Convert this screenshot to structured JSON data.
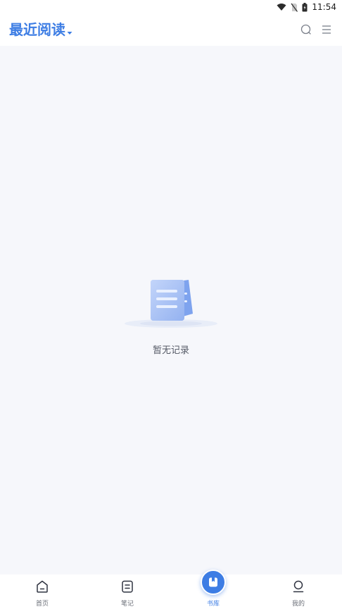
{
  "status_bar": {
    "time": "11:54",
    "icons": [
      "wifi-icon",
      "no-sim-icon",
      "battery-charging-icon"
    ]
  },
  "header": {
    "title": "最近阅读",
    "icons": [
      "chevron-down-icon",
      "search-icon",
      "menu-icon"
    ]
  },
  "empty_state": {
    "message": "暂无记录",
    "icon": "document-stack-illustration"
  },
  "tabbar": {
    "active": "书库",
    "tabs": [
      {
        "label": "首页",
        "icon": "home-icon"
      },
      {
        "label": "笔记",
        "icon": "notes-icon"
      },
      {
        "label": "书库",
        "icon": "bookshelf-icon"
      },
      {
        "label": "我的",
        "icon": "profile-icon"
      }
    ]
  },
  "colors": {
    "accent": "#3d7de4",
    "background": "#f6f7fb",
    "surface": "#ffffff",
    "muted_text": "#555a66"
  }
}
